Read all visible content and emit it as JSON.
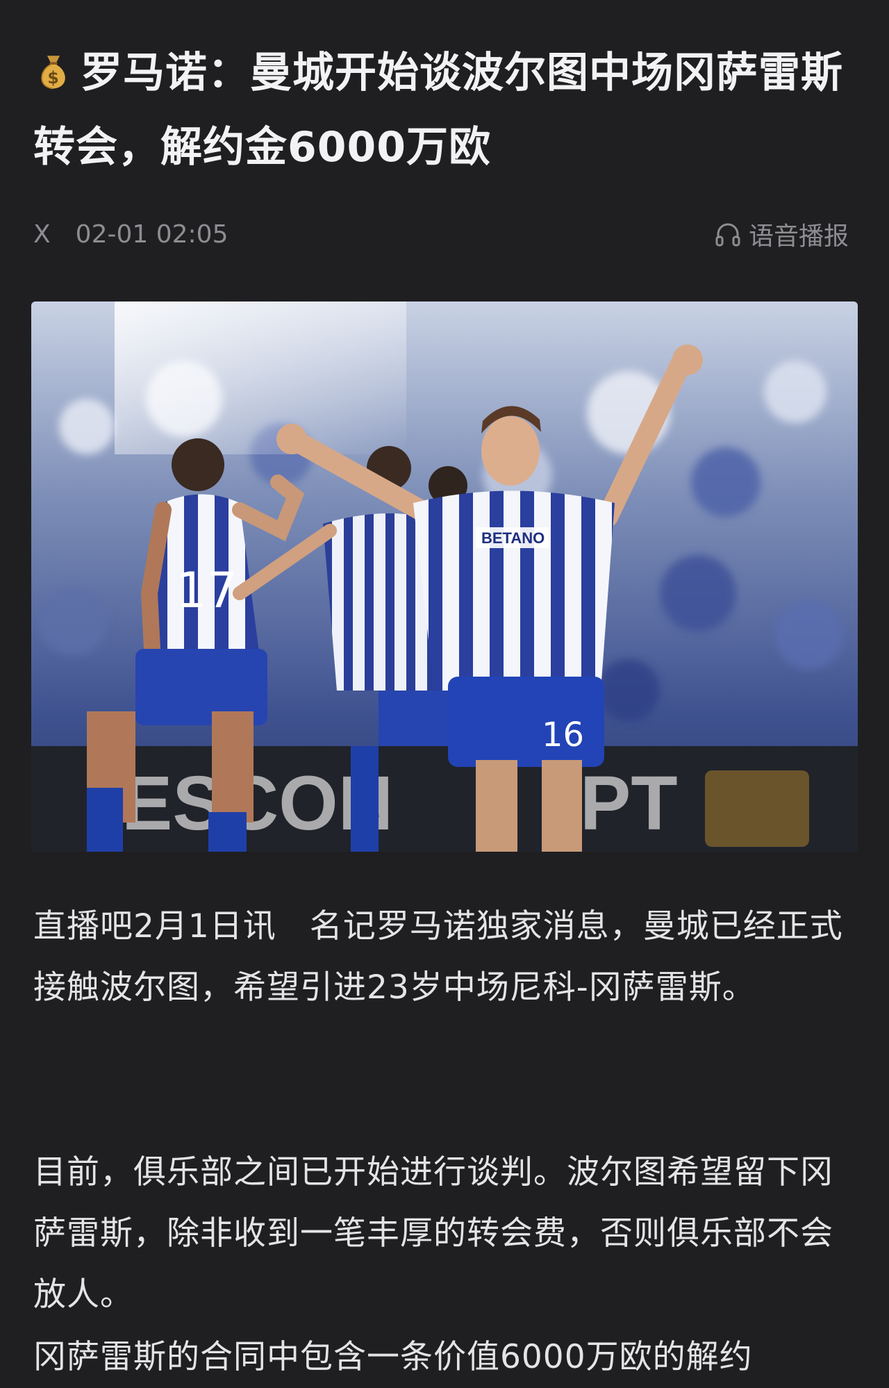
{
  "article": {
    "title_icon": "money-bag-icon",
    "title": "罗马诺：曼城开始谈波尔图中场冈萨雷斯转会，解约金6000万欧",
    "source": "X",
    "datetime": "02-01 02:05",
    "audio_label": "语音播报",
    "audio_icon": "headphones-icon",
    "paragraphs": [
      "直播吧2月1日讯　名记罗马诺独家消息，曼城已经正式接触波尔图，希望引进23岁中场尼科-冈萨雷斯。",
      "目前，俱乐部之间已开始进行谈判。波尔图希望留下冈萨雷斯，除非收到一笔丰厚的转会费，否则俱乐部不会放人。",
      "冈萨雷斯的合同中包含一条价值6000万欧的解约"
    ]
  },
  "colors": {
    "background": "#1f1f21",
    "title": "#f2f2f4",
    "meta": "#8d8d92",
    "body": "#e4e4e6"
  }
}
